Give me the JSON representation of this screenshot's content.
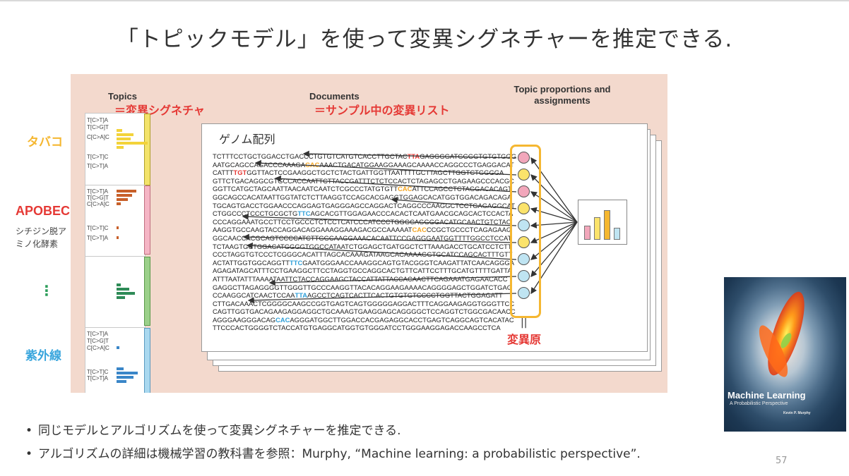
{
  "title": "「トピックモデル」を使って変異シグネチャーを推定できる.",
  "figure": {
    "topics_heading": "Topics",
    "topics_eq": "＝変異シグネチャ",
    "documents_heading": "Documents",
    "documents_eq": "＝サンプル中の変異リスト",
    "proportions_heading": "Topic proportions and assignments",
    "genome_title": "ゲノム配列",
    "mutagen_eq": "||",
    "mutagen_label": "変異原"
  },
  "signatures": {
    "tobacco": {
      "name": "タバコ",
      "color": "#f5b731"
    },
    "apobec": {
      "name": "APOBEC",
      "sub1": "シチジン脱ア",
      "sub2": "ミノ化酵素",
      "color": "#e53935"
    },
    "ellipsis": {
      "text": "⋮",
      "color": "#2e9e5b"
    },
    "uv": {
      "name": "紫外線",
      "color": "#3aa6dd"
    }
  },
  "panel_labels": {
    "p1": [
      "T[C>T]A",
      "T[C>G]T",
      "C[C>A]C",
      "T[C>T]C",
      "T[C>T]A"
    ],
    "p2": [
      "T[C>T]A",
      "T[C>G]T",
      "C[C>A]C",
      "T[C>T]C",
      "T[C>T]A"
    ],
    "p4": [
      "T[C>T]A",
      "T[C>G]T",
      "C[C>A]C",
      "T[C>T]C",
      "T[C>T]A"
    ]
  },
  "sequence_lines": [
    "TCTTTCCTGCTGGACCTGACCCTGTGTCATGTCACCTTGCTAC|TTA|GAGGGGATGGGGTGTGTGGG",
    "AATGCAGCCAGACCCAAAGA|CAC|AAACTGACATGGAAGGAAAGCAAAACCAGGCCCTGAGGACAT",
    "CATTT|TGT|GGTTACTCCGAAGGCTGCTCTACTGATTGGTTAATTTTGCTTAGCTTGGTCTGGGGA",
    "GTTCTGACAGGCGTGCCACCAATTCTTACCGATTTCTCTCCACTCTAGAGCCTGAGAAGCCCACGC",
    "GGTTCATGCTAGCAATTAACAATCAATCTCGCCCTATGTGTT|CAC|ATTCCAGCCTCTAGGACACAGT",
    "GGCAGCCACATAATTGGTATCTCTTAAGGTCCAGCACGAGGTGGAGCACATGGTGGACAGACAGA",
    "TGCAGTGACCTGGAACCCAGGAGTGAGGGAGCCAGGACTCAGGCCCAAGGCTCCTGAGAGGCAT",
    "CTGGCCCTCCCTGCGCTG|TTC|AGCACGTTGGAGAACCCACACTCAATGAACGCAGCACTCCACTA",
    "CCCAGGAAATGCCTTCCTGCCCTCTCCTCATCCCATCCCTGGGCAGGGGACATGCAACTGTCTAC",
    "AAGGTGCCAAGTACCAGGACAGGAAAGGAAAGACGCCAAAAAT|CAC|CCGCTGCCCTCAGAGAAG",
    "GGCAACCACGCAGTCCCCATCTTGGCAAGGAAACACAATTCCGAGGGAATGGTTTTGGCCTCCAT",
    "TCTAAGTGCTGGACATGGGGTGGCCATAATCTGGAGCTGATGGCTCTTAAAGACCTGCATCCTCTT",
    "CCCTAGGTGTCCCTCGGGCACATTTAGCACAAAGATAAGCACAAAAGGTGCATCCAGCACTTTGTT",
    "ACTATTGGTGGCAGGTT|TTC|GAATGGGAACCAAAGGCAGTGTACGGGTCAAGATTATCAACAGGGA",
    "AGAGATAGCATTTCCTGAAGGCTTCCTAGGTGCCAGGCACTGTTCATTCCTTTGCATGTTTTGATTA",
    "ATTTAATATTTAAAATAATTCTACCAGGAAGCTACCATTATTACCACAACTTCAGAAATGAGAACACC",
    "GAGGCTTAGAGGGGTTGGGTTGCCCAAGGTTACACAGGAAGAAAACAGGGGAGCTGGATCTGAG",
    "CCAAGGCATCAACTCCAA|TTA|AGCCTCAGTCACTTCACTGTGTGTCCCCTGGTTACTGGAGATT",
    "CTTGACAAACTCGGGGCAAGCCGGTGAGTCAGTGGGGGAGGACTTTCAGGAAGAGGTGGGTTCC",
    "CAGTTGGTGACAGAAGAGGAGGCTGCAAAGTGAAGGAGCAGGGGCTCCAGGTCTGGCGACAACC",
    "AGGGAAGGGACAG|CAC|AGGGATGGCTTGGACCACGAGAGGCACCTGAGTCAGGCAGTCACATAC",
    "TTCCCACTGGGGTCTACCATGTGAGGCATGGTGTGGGATCCTGGGAAGGAGACCAAGCCTCA"
  ],
  "seq_highlight_colors": [
    "R",
    "O",
    "R",
    "",
    "O",
    "",
    "",
    "B",
    "",
    "O",
    "",
    "",
    "",
    "B",
    "",
    "",
    "",
    "B",
    "",
    "",
    "B",
    ""
  ],
  "nodes": [
    "#f2a7bb",
    "#fbe36b",
    "#f2a7bb",
    "#fbe36b",
    "#bfe4f2",
    "#fbe36b",
    "#bfe4f2",
    "#bfe4f2",
    "#bfe4f2"
  ],
  "mini_bars": [
    {
      "color": "#f2a7bb",
      "value": 0.45
    },
    {
      "color": "#fbe36b",
      "value": 0.75
    },
    {
      "color": "#f5b731",
      "value": 1.0
    },
    {
      "color": "#bfe4f2",
      "value": 0.38
    }
  ],
  "book_cover": {
    "title": "Machine Learning",
    "subtitle": "A Probabilistic Perspective",
    "author": "Kevin P. Murphy"
  },
  "bullets": [
    "同じモデルとアルゴリズムを使って変異シグネチャーを推定できる.",
    "アルゴリズムの詳細は機械学習の教科書を参照：Murphy, “Machine learning: a probabilistic perspective”."
  ],
  "bullet_marker": "•",
  "page_number": "57"
}
